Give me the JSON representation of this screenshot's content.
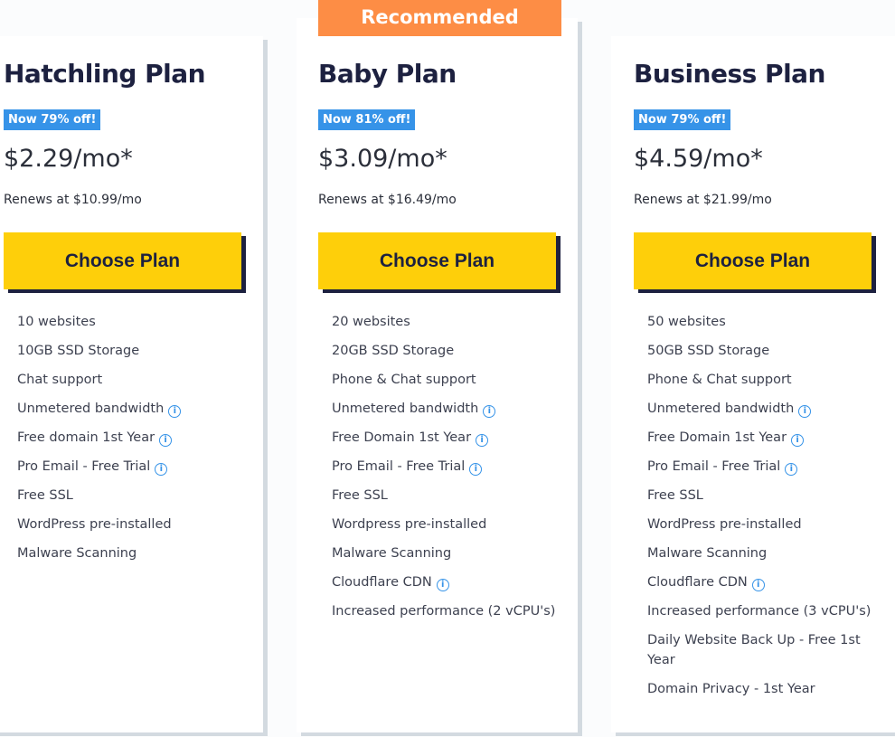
{
  "recommended_label": "Recommended",
  "colors": {
    "accent_orange": "#fd8d45",
    "badge_blue": "#3693e8",
    "button_yellow": "#fecf0a",
    "navy": "#1d2140"
  },
  "plans": [
    {
      "title": "Hatchling Plan",
      "badge": "Now 79% off!",
      "price": "$2.29/mo*",
      "renews": "Renews at $10.99/mo",
      "button": "Choose Plan",
      "features": [
        {
          "text": "10 websites"
        },
        {
          "text": "10GB SSD Storage"
        },
        {
          "text": "Chat support"
        },
        {
          "text": "Unmetered bandwidth",
          "info": true
        },
        {
          "text": "Free domain 1st Year",
          "info": true
        },
        {
          "text": "Pro Email - Free Trial",
          "info": true
        },
        {
          "text": "Free SSL"
        },
        {
          "text": "WordPress pre-installed"
        },
        {
          "text": "Malware Scanning"
        }
      ]
    },
    {
      "title": "Baby Plan",
      "badge": "Now 81% off!",
      "price": "$3.09/mo*",
      "renews": "Renews at $16.49/mo",
      "button": "Choose Plan",
      "features": [
        {
          "text": "20 websites"
        },
        {
          "text": "20GB SSD Storage"
        },
        {
          "text": "Phone & Chat support"
        },
        {
          "text": "Unmetered bandwidth",
          "info": true
        },
        {
          "text": "Free Domain 1st Year",
          "info": true
        },
        {
          "text": "Pro Email - Free Trial",
          "info": true
        },
        {
          "text": "Free SSL"
        },
        {
          "text": "Wordpress pre-installed"
        },
        {
          "text": "Malware Scanning"
        },
        {
          "text": "Cloudflare CDN",
          "info": true
        },
        {
          "text": "Increased performance (2 vCPU's)"
        }
      ]
    },
    {
      "title": "Business Plan",
      "badge": "Now 79% off!",
      "price": "$4.59/mo*",
      "renews": "Renews at $21.99/mo",
      "button": "Choose Plan",
      "features": [
        {
          "text": "50 websites"
        },
        {
          "text": "50GB SSD Storage"
        },
        {
          "text": "Phone & Chat support"
        },
        {
          "text": "Unmetered bandwidth",
          "info": true
        },
        {
          "text": "Free Domain 1st Year",
          "info": true
        },
        {
          "text": "Pro Email - Free Trial",
          "info": true
        },
        {
          "text": "Free SSL"
        },
        {
          "text": "WordPress pre-installed"
        },
        {
          "text": "Malware Scanning"
        },
        {
          "text": "Cloudflare CDN",
          "info": true
        },
        {
          "text": "Increased performance (3 vCPU's)"
        },
        {
          "text": "Daily Website Back Up - Free 1st Year"
        },
        {
          "text": "Domain Privacy - 1st Year"
        }
      ]
    }
  ]
}
